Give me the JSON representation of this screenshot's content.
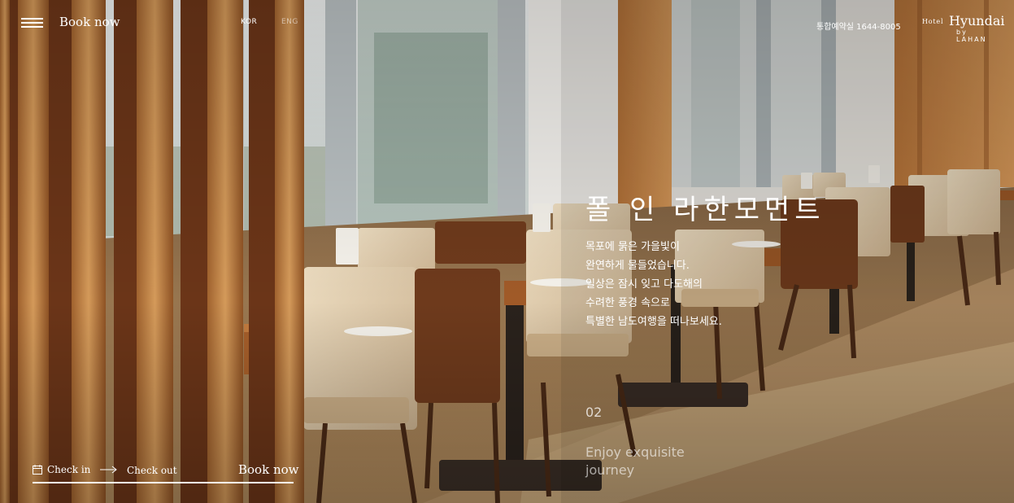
{
  "header": {
    "book_now": "Book now",
    "lang_kor": "KOR",
    "lang_eng": "ENG",
    "reservation": "통합예약실 1644-8005",
    "logo": {
      "hotel": "Hotel",
      "brand": "Hyundai",
      "by": "by LAHAN"
    }
  },
  "hero": {
    "title": "폴 인 라한모먼트",
    "lines": [
      "목포에 묽은 가을빛이",
      "완연하게 물들었습니다.",
      "일상은 잠시 잊고 다도해의",
      "수려한 풍경 속으로",
      "특별한 남도여행을 떠나보세요."
    ]
  },
  "slide": {
    "number": "02",
    "caption_line1": "Enjoy exquisite",
    "caption_line2": "journey"
  },
  "booking": {
    "check_in": "Check in",
    "check_out": "Check out",
    "book_now": "Book now"
  },
  "icons": [
    "menu-icon",
    "calendar-icon",
    "arrow-right-icon"
  ]
}
